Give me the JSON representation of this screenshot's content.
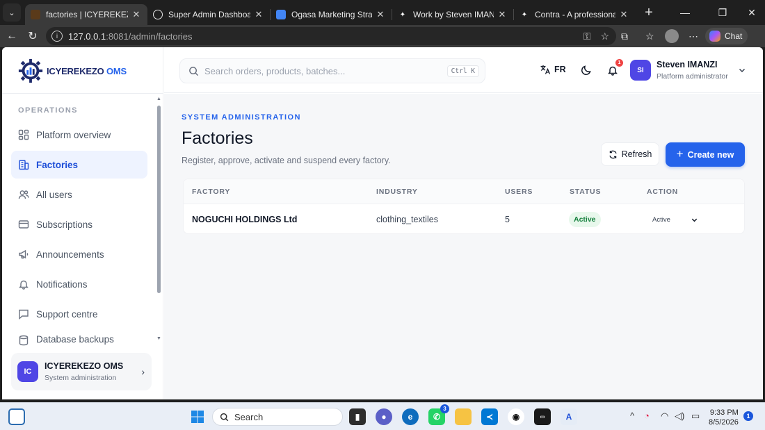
{
  "browser": {
    "tabs": [
      {
        "title": "factories | ICYEREKEZO OMS",
        "active": true
      },
      {
        "title": "Super Admin Dashboard - L",
        "active": false
      },
      {
        "title": "Ogasa Marketing Strategy P",
        "active": false
      },
      {
        "title": "Work by Steven IMANZI",
        "active": false
      },
      {
        "title": "Contra - A professional netw",
        "active": false
      }
    ],
    "url_host": "127.0.0.1",
    "url_rest": ":8081/admin/factories",
    "chat_label": "Chat"
  },
  "brand": {
    "name": "ICYEREKEZO",
    "suffix": "OMS",
    "primary": "#2563eb",
    "dark": "#1e2a6b"
  },
  "sidebar": {
    "section_label": "OPERATIONS",
    "items": [
      {
        "label": "Platform overview",
        "icon": "grid-icon",
        "active": false
      },
      {
        "label": "Factories",
        "icon": "building-icon",
        "active": true
      },
      {
        "label": "All users",
        "icon": "users-icon",
        "active": false
      },
      {
        "label": "Subscriptions",
        "icon": "credit-card-icon",
        "active": false
      },
      {
        "label": "Announcements",
        "icon": "megaphone-icon",
        "active": false
      },
      {
        "label": "Notifications",
        "icon": "bell-icon",
        "active": false
      },
      {
        "label": "Support centre",
        "icon": "chat-icon",
        "active": false
      },
      {
        "label": "Database backups",
        "icon": "database-icon",
        "active": false
      }
    ],
    "org": {
      "initials": "IC",
      "name": "ICYEREKEZO OMS",
      "subtitle": "System administration"
    }
  },
  "topbar": {
    "search_placeholder": "Search orders, products, batches...",
    "shortcut": "Ctrl K",
    "language": "FR",
    "notification_count": "1",
    "user": {
      "initials": "SI",
      "name": "Steven IMANZI",
      "role": "Platform administrator"
    }
  },
  "page": {
    "eyebrow": "SYSTEM ADMINISTRATION",
    "title": "Factories",
    "subtitle": "Register, approve, activate and suspend every factory.",
    "refresh_label": "Refresh",
    "create_label": "Create new"
  },
  "table": {
    "columns": [
      "FACTORY",
      "INDUSTRY",
      "USERS",
      "STATUS",
      "ACTION"
    ],
    "rows": [
      {
        "factory": "NOGUCHI HOLDINGS Ltd",
        "industry": "clothing_textiles",
        "users": "5",
        "status": "Active",
        "action": "Active"
      }
    ]
  },
  "taskbar": {
    "search_label": "Search",
    "whatsapp_badge": "3",
    "time": "9:33 PM",
    "date": "8/5/2026",
    "notification_count": "1"
  }
}
